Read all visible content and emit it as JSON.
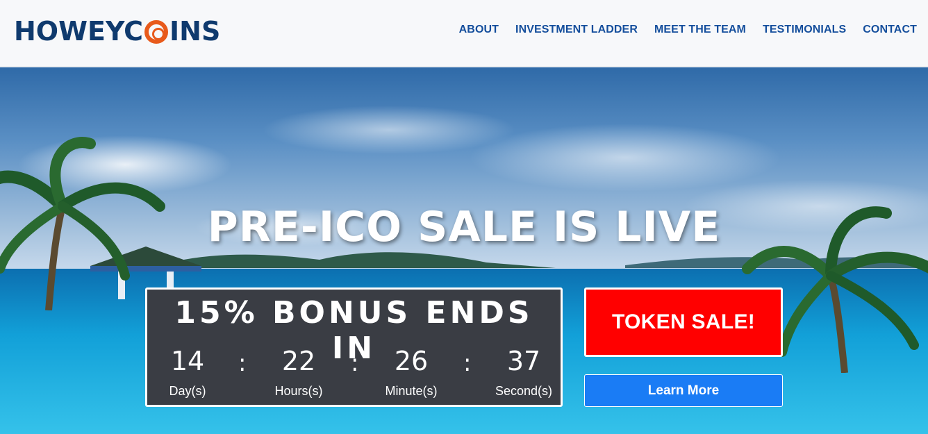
{
  "header": {
    "logo_text": "HOWEYCOINS",
    "nav": [
      {
        "label": "ABOUT"
      },
      {
        "label": "INVESTMENT LADDER"
      },
      {
        "label": "MEET THE TEAM"
      },
      {
        "label": "TESTIMONIALS"
      },
      {
        "label": "CONTACT"
      }
    ]
  },
  "hero": {
    "title": "PRE-ICO SALE IS LIVE",
    "countdown": {
      "title": "15% BONUS ENDS IN",
      "units": [
        {
          "value": "14",
          "label": "Day(s)"
        },
        {
          "value": "22",
          "label": "Hours(s)"
        },
        {
          "value": "26",
          "label": "Minute(s)"
        },
        {
          "value": "37",
          "label": "Second(s)"
        }
      ],
      "separator": ":"
    },
    "token_button": "TOKEN SALE!",
    "learn_button": "Learn More"
  },
  "colors": {
    "brand_navy": "#0f3a6e",
    "brand_orange": "#e85a1b",
    "nav_blue": "#144e9c",
    "token_red": "#ff0000",
    "learn_blue": "#1a7cf5",
    "countdown_bg": "#3a3d44"
  }
}
